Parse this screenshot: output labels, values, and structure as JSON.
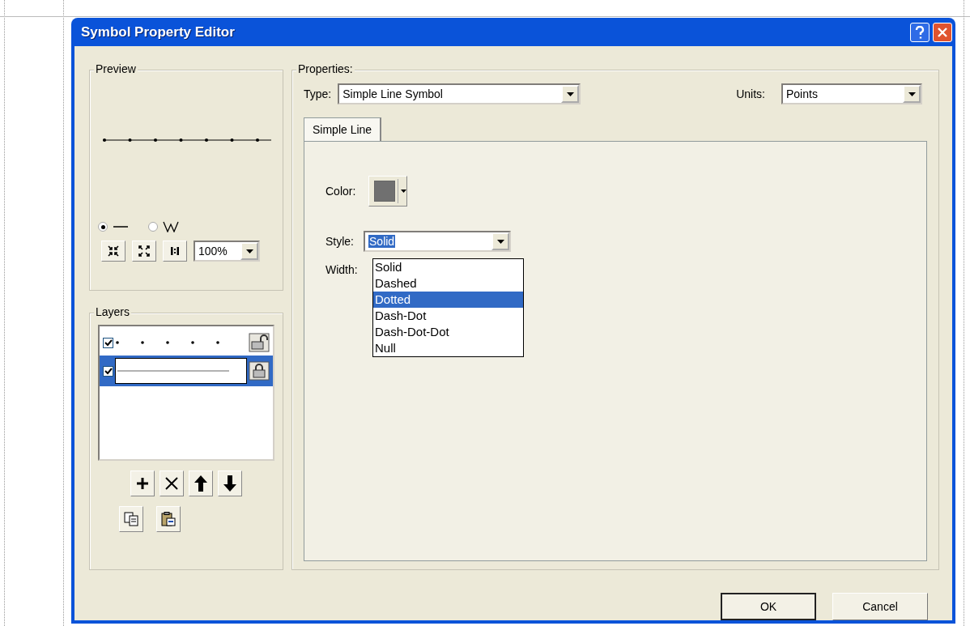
{
  "window": {
    "title": "Symbol Property Editor"
  },
  "preview": {
    "title": "Preview",
    "line_modes": [
      {
        "kind": "line",
        "selected": true
      },
      {
        "kind": "zigzag",
        "selected": false
      }
    ],
    "zoom": "100%"
  },
  "layers": {
    "title": "Layers",
    "items": [
      {
        "kind": "dots",
        "checked": true,
        "selected": false,
        "locked": false
      },
      {
        "kind": "solid",
        "checked": true,
        "selected": true,
        "locked": true
      }
    ]
  },
  "properties": {
    "title": "Properties:",
    "type_label": "Type:",
    "type_value": "Simple Line Symbol",
    "units_label": "Units:",
    "units_value": "Points",
    "tabs": [
      {
        "label": "Simple Line",
        "selected": true
      }
    ],
    "color_label": "Color:",
    "swatch": {
      "color": "#707070"
    },
    "style_label": "Style:",
    "style_value": "Solid",
    "width_label": "Width:",
    "style_options": [
      {
        "label": "Solid",
        "selected": false
      },
      {
        "label": "Dashed",
        "selected": false
      },
      {
        "label": "Dotted",
        "selected": true
      },
      {
        "label": "Dash-Dot",
        "selected": false
      },
      {
        "label": "Dash-Dot-Dot",
        "selected": false
      },
      {
        "label": "Null",
        "selected": false
      }
    ]
  },
  "buttons": [
    "OK",
    "Cancel"
  ]
}
